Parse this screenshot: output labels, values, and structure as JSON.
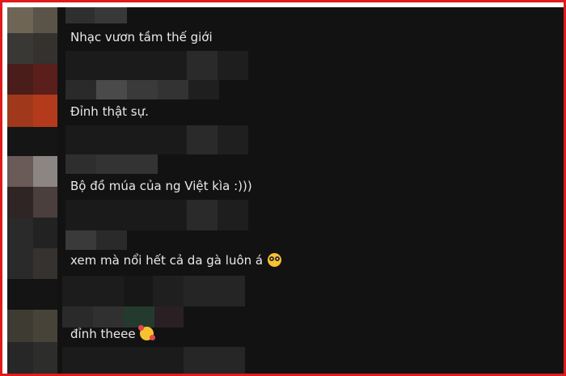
{
  "comments": [
    {
      "text": "Nhạc vươn tầm thế giới",
      "emoji": ""
    },
    {
      "text": "Đỉnh thật sự.",
      "emoji": ""
    },
    {
      "text": "Bộ đồ múa của ng Việt kìa :)))",
      "emoji": ""
    },
    {
      "text": "xem mà nổi hết cả da gà luôn á",
      "emoji": "flushed-face-emoji"
    },
    {
      "text": "đỉnh theee",
      "emoji": "smiling-face-with-hearts-emoji"
    }
  ],
  "colors": {
    "frame_border": "#e01b1b",
    "background": "#121212",
    "text": "#e9e9e9"
  }
}
